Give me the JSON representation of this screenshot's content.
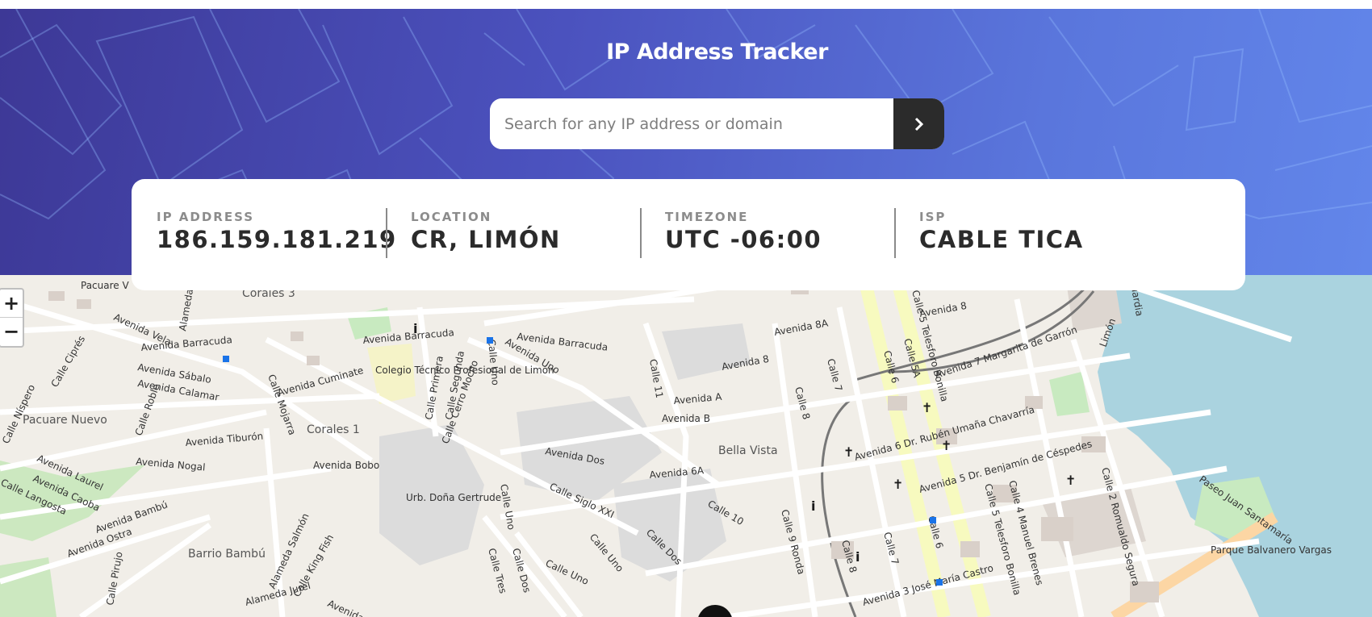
{
  "header": {
    "title": "IP Address Tracker",
    "background_colors": [
      "#3d3896",
      "#6286ea"
    ]
  },
  "search": {
    "placeholder": "Search for any IP address or domain",
    "value": "",
    "button_icon": "chevron-right-icon"
  },
  "info": [
    {
      "label": "IP Address",
      "value": "186.159.181.219"
    },
    {
      "label": "Location",
      "value": "CR, LIMÓN"
    },
    {
      "label": "Timezone",
      "value": "UTC -06:00"
    },
    {
      "label": "ISP",
      "value": "CABLE TICA"
    }
  ],
  "map": {
    "zoom_in_label": "+",
    "zoom_out_label": "−",
    "marker_icon": "location-marker-icon",
    "streets": [
      "Pacuare V",
      "Corales 3",
      "Avenida Vela",
      "Alameda Tin",
      "Avenida Barracuda",
      "Avenida Barracuda",
      "Avenida Barracuda",
      "Calle Ciprés",
      "Avenida Sábalo",
      "Avenida Calamar",
      "Calle Roble",
      "Avenida Cuminate",
      "Calle Mojarra",
      "Colegio Técnico Profesional de Limón",
      "Calle Primera",
      "Calle Segunda",
      "Calle Uno",
      "Avenida Uno",
      "Calle Cerro Mocho",
      "Corales 1",
      "Pacuare Nuevo",
      "Calle Níspero",
      "Avenida Laurel",
      "Avenida Caoba",
      "Calle Langosta",
      "Avenida Nogal",
      "Avenida Tiburón",
      "Avenida Bobo",
      "Urb. Doña Gertrude",
      "Avenida Dos",
      "Calle Siglo XXI",
      "Avenida 6A",
      "Avenida Bambú",
      "Avenida Ostra",
      "Barrio Bambú",
      "Alameda Salmón",
      "Calle King Fish",
      "Alameda Jurel",
      "Calle Tres",
      "Calle Dos",
      "Calle Uno",
      "Calle Uno",
      "Calle Dos",
      "Calle Uno",
      "Calle 11",
      "Avenida A",
      "Avenida B",
      "Bella Vista",
      "Calle 10",
      "Calle 9 Ronda",
      "Avenida 8",
      "Avenida 8A",
      "Avenida 8",
      "Calle 8",
      "Calle 7",
      "Calle 6",
      "Calle 5A",
      "Calle 5 Telesforo Bonilla",
      "Avenida 7 Margarita de Garrón",
      "Avenida 6 Dr. Rubén Umaña Chavarría",
      "Avenida 5 Dr. Benjamín de Céspedes",
      "Calle 4 Manuel Brenes",
      "Calle 2 Romualdo Segura",
      "Paseo Juan Santamaría",
      "Parque Balvanero Vargas",
      "Avenida 3 José María Castro",
      "Calle 6",
      "Calle 5 Telesforo Bonilla",
      "Calle 7",
      "Calle 8",
      "Limón",
      "Guardia",
      "Calle Pirujo",
      "Avenida Ma"
    ]
  }
}
